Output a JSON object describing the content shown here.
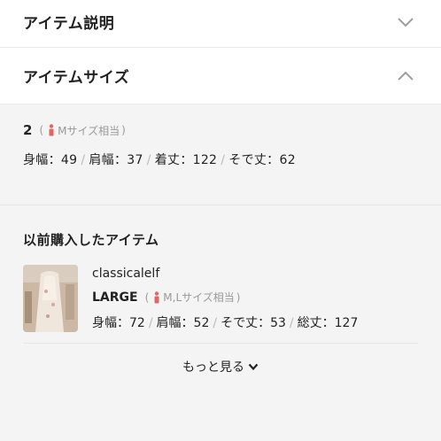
{
  "item_description": {
    "title": "アイテム説明",
    "icon": "chevron-down-icon"
  },
  "item_size": {
    "title": "アイテムサイズ",
    "icon": "chevron-up-icon",
    "size_label": "2",
    "size_hint_open": "(",
    "size_hint": "Mサイズ相当",
    "size_hint_close": ")",
    "measurements": [
      "身幅：49",
      "肩幅：37",
      "着丈：122",
      "そで丈：62"
    ],
    "separator": "/"
  },
  "previous_purchases": {
    "title": "以前購入したアイテム",
    "item": {
      "brand": "classicalelf",
      "size_label": "LARGE",
      "size_hint_open": "(",
      "size_hint": "M,Lサイズ相当",
      "size_hint_close": ")",
      "measurements": [
        "身幅：72",
        "肩幅：52",
        "そで丈：53",
        "総丈：127"
      ]
    },
    "more_label": "もっと見る"
  },
  "colors": {
    "person_icon": "#e06666",
    "chevron": "#9e9e9e"
  }
}
